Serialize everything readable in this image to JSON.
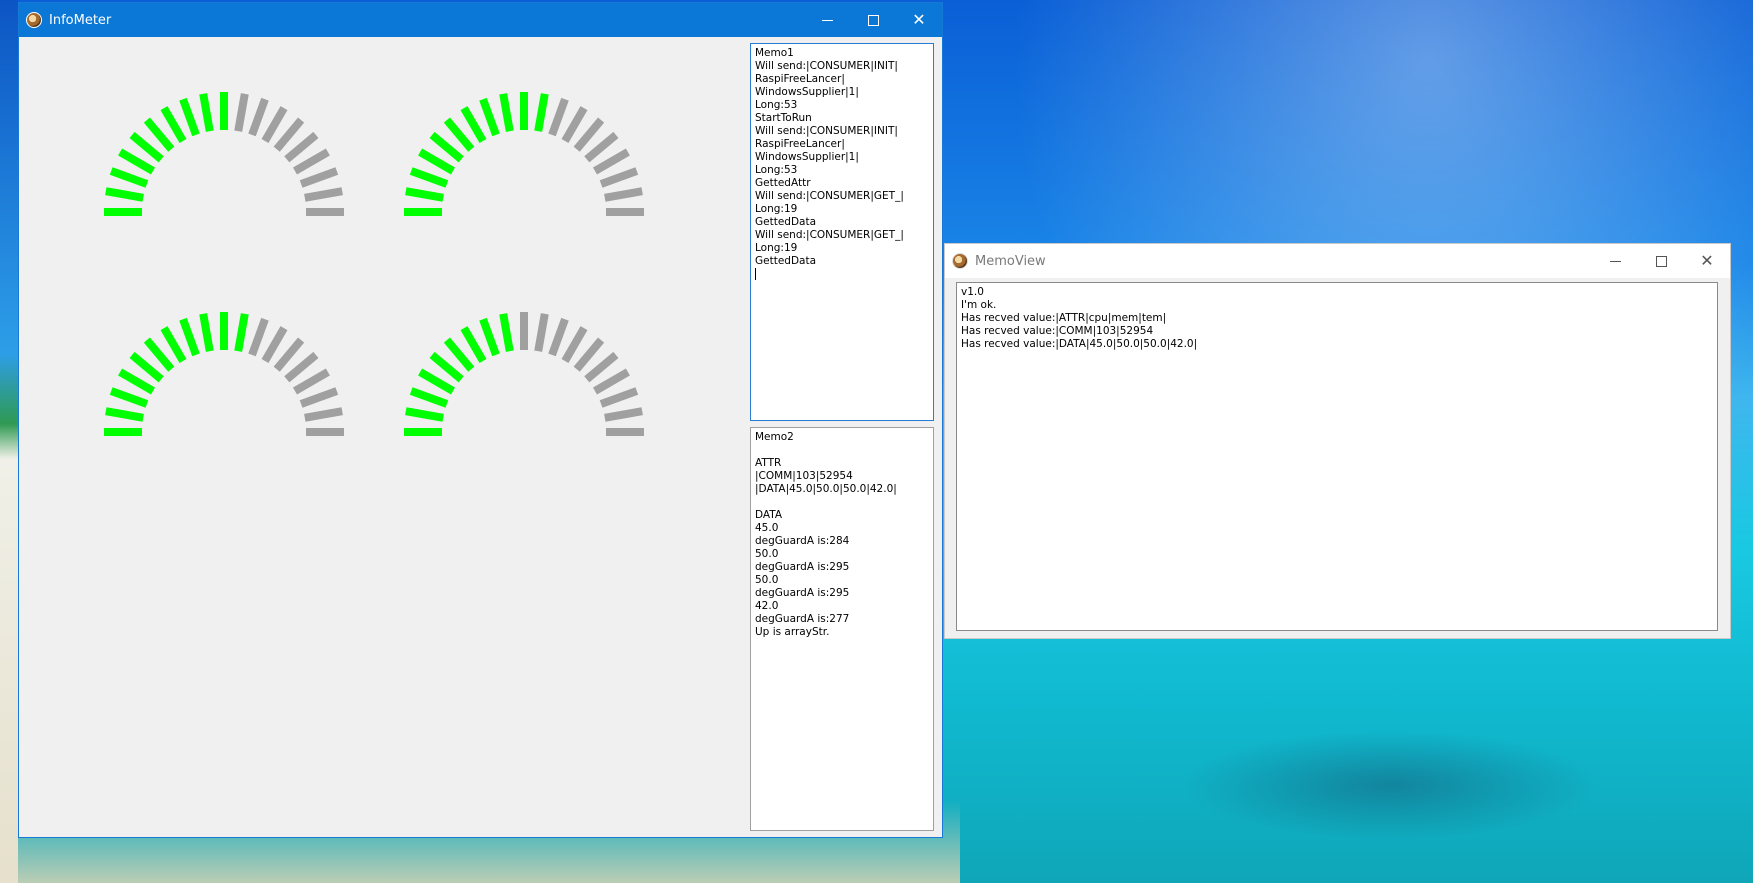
{
  "main_window": {
    "title": "InfoMeter",
    "controls": {
      "minimize": "—",
      "maximize": "☐",
      "close": "✕"
    }
  },
  "gauges": [
    {
      "name": "gauge-top-left",
      "segments_total": 19,
      "segments_active": 10,
      "active_color": "#00ff00",
      "inactive_color": "#a0a0a0"
    },
    {
      "name": "gauge-top-right",
      "segments_total": 19,
      "segments_active": 11,
      "active_color": "#00ff00",
      "inactive_color": "#a0a0a0"
    },
    {
      "name": "gauge-bottom-left",
      "segments_total": 19,
      "segments_active": 11,
      "active_color": "#00ff00",
      "inactive_color": "#a0a0a0"
    },
    {
      "name": "gauge-bottom-right",
      "segments_total": 19,
      "segments_active": 9,
      "active_color": "#00ff00",
      "inactive_color": "#a0a0a0"
    }
  ],
  "memo1": {
    "lines": [
      "Memo1",
      "Will send:|CONSUMER|INIT|",
      "RaspiFreeLancer|",
      "WindowsSupplier|1|",
      "Long:53",
      "StartToRun",
      "Will send:|CONSUMER|INIT|",
      "RaspiFreeLancer|",
      "WindowsSupplier|1|",
      "Long:53",
      "GettedAttr",
      "Will send:|CONSUMER|GET_|",
      "Long:19",
      "GettedData",
      "Will send:|CONSUMER|GET_|",
      "Long:19",
      "GettedData"
    ]
  },
  "memo2": {
    "lines": [
      "Memo2",
      "",
      "ATTR",
      "|COMM|103|52954",
      "|DATA|45.0|50.0|50.0|42.0|",
      "",
      "DATA",
      "45.0",
      "degGuardA is:284",
      "50.0",
      "degGuardA is:295",
      "50.0",
      "degGuardA is:295",
      "42.0",
      "degGuardA is:277",
      "Up is arrayStr."
    ]
  },
  "memo_window": {
    "title": "MemoView",
    "controls": {
      "minimize": "—",
      "maximize": "☐",
      "close": "✕"
    },
    "lines": [
      "v1.0",
      "I'm ok.",
      "Has recved value:|ATTR|cpu|mem|tem|",
      "Has recved value:|COMM|103|52954",
      "Has recved value:|DATA|45.0|50.0|50.0|42.0|"
    ]
  }
}
